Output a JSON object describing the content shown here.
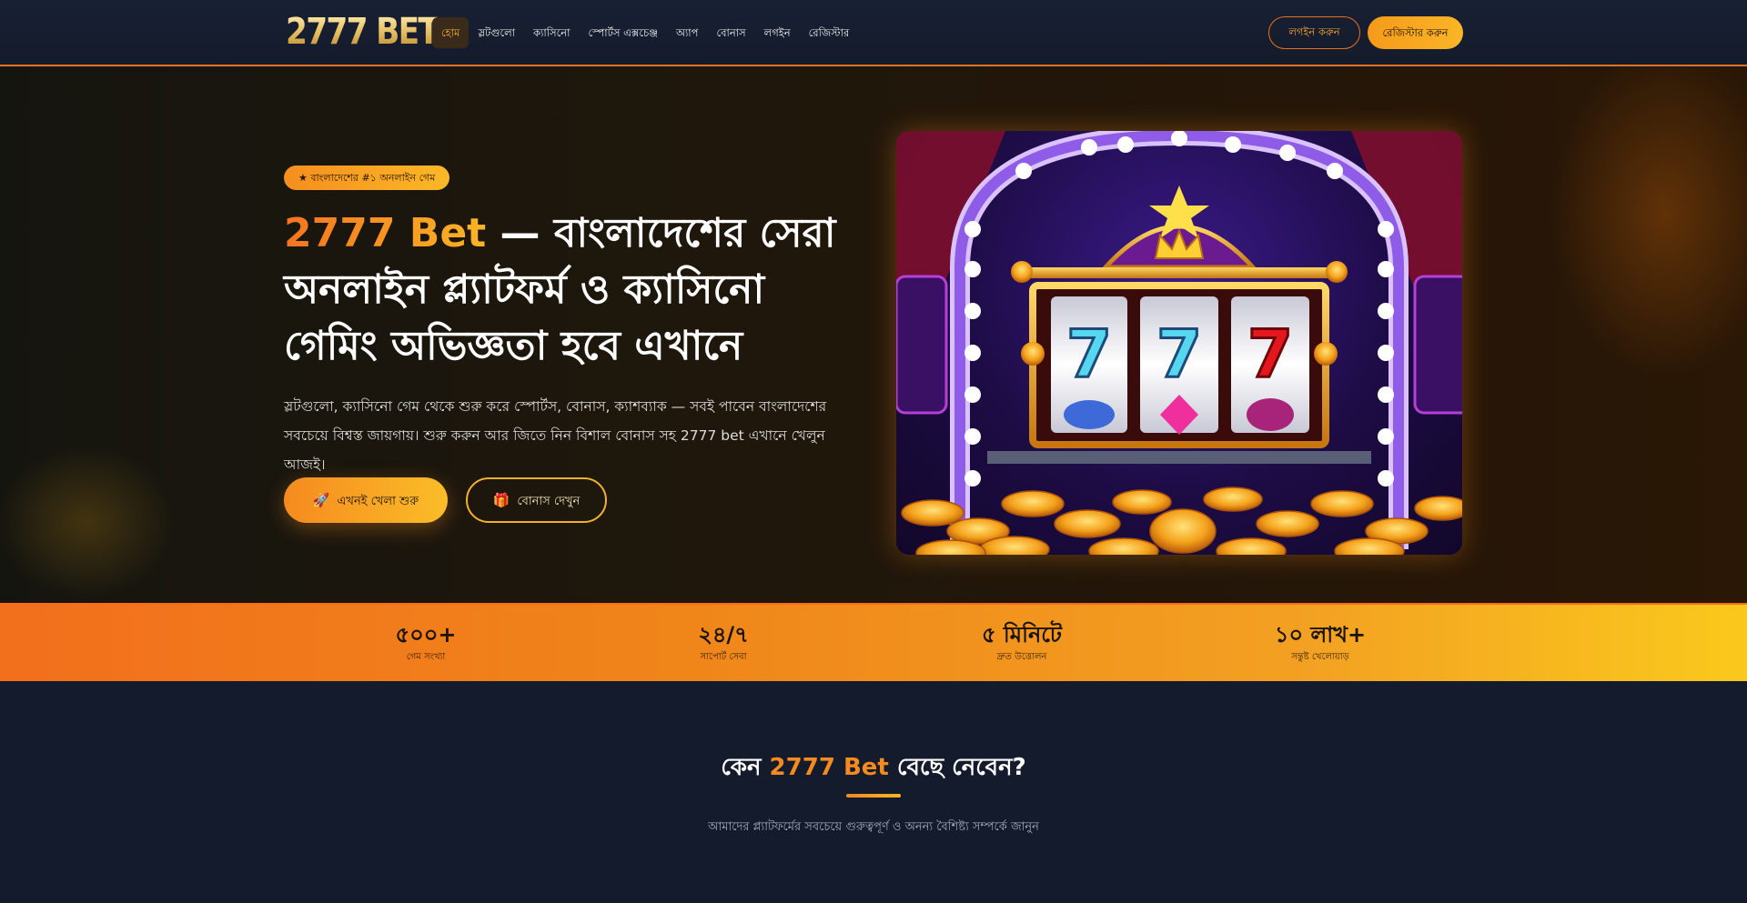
{
  "header": {
    "logo": "2777 BET",
    "nav": [
      "হোম",
      "স্লটগুলো",
      "ক্যাসিনো",
      "স্পোর্টস এক্সচেঞ্জ",
      "অ্যাপ",
      "বোনাস",
      "লগইন",
      "রেজিস্টার"
    ],
    "login_label": "লগইন করুন",
    "register_label": "রেজিস্টার করুন"
  },
  "hero": {
    "badge": "★ বাংলাদেশের #১ অনলাইন গেম",
    "title_brand": "2777 Bet",
    "title_rest": " — বাংলাদেশের সেরা অনলাইন প্ল্যাটফর্ম ও ক্যাসিনো গেমিং অভিজ্ঞতা হবে এখানে",
    "description": "স্লটগুলো, ক্যাসিনো গেম থেকে শুরু করে স্পোর্টস, বোনাস, ক্যাশব্যাক — সবই পাবেন বাংলাদেশের সবচেয়ে বিশ্বস্ত জায়গায়। শুরু করুন আর জিতে নিন বিশাল বোনাস সহ 2777 bet এখানে খেলুন আজই।",
    "primary_cta": "এখনই খেলা শুরু",
    "secondary_cta": "বোনাস দেখুন",
    "primary_icon": "rocket-icon",
    "secondary_icon": "gift-icon"
  },
  "stats": [
    {
      "value": "৫০০+",
      "label": "গেম সংখ্যা"
    },
    {
      "value": "২৪/৭",
      "label": "সাপোর্ট সেবা"
    },
    {
      "value": "৫ মিনিটে",
      "label": "দ্রুত উত্তোলন"
    },
    {
      "value": "১০ লাখ+",
      "label": "সন্তুষ্ট খেলোয়াড়"
    }
  ],
  "why": {
    "title_prefix": "কেন ",
    "title_brand": "2777 Bet",
    "title_suffix": " বেছে নেবেন?",
    "subtitle": "আমাদের প্ল্যাটফর্মের সবচেয়ে গুরুত্বপূর্ণ ও অনন্য বৈশিষ্ট্য সম্পর্কে জানুন"
  },
  "colors": {
    "accent": "#f58a1f",
    "accent_light": "#fbb526",
    "background": "#141b2d"
  }
}
